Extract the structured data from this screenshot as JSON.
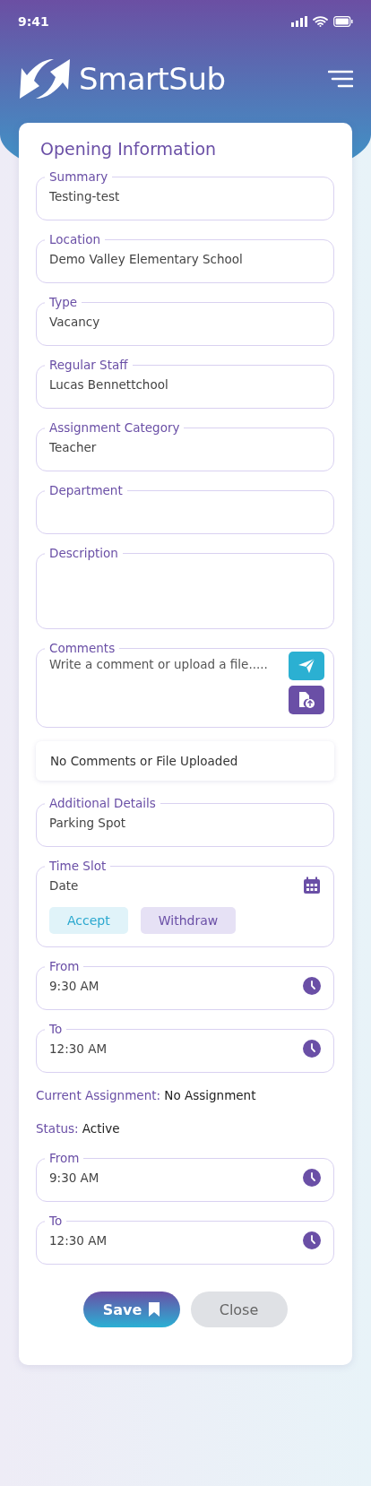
{
  "status_bar": {
    "time": "9:41"
  },
  "header": {
    "logo_text": "SmartSub"
  },
  "card": {
    "title": "Opening Information",
    "items": [
      {
        "kind": "field",
        "label": "Summary",
        "value": "Testing-test"
      },
      {
        "kind": "field",
        "label": "Location",
        "value": "Demo Valley Elementary School"
      },
      {
        "kind": "field",
        "label": "Type",
        "value": "Vacancy"
      },
      {
        "kind": "field",
        "label": "Regular Staff",
        "value": "Lucas Bennettchool"
      },
      {
        "kind": "field",
        "label": "Assignment Category",
        "value": "Teacher"
      },
      {
        "kind": "field",
        "label": "Department"
      },
      {
        "kind": "textarea",
        "label": "Description"
      },
      {
        "kind": "comments",
        "label": "Comments",
        "placeholder": "Write a comment or upload a file....."
      },
      {
        "kind": "note",
        "text": "No Comments or File Uploaded"
      },
      {
        "kind": "field",
        "label": "Additional Details",
        "value": "Parking Spot"
      },
      {
        "kind": "timeslot",
        "label": "Time Slot",
        "value": "Date",
        "actions": [
          {
            "label": "Accept",
            "kind": "accept"
          },
          {
            "label": "Withdraw",
            "kind": "withdraw"
          }
        ]
      },
      {
        "kind": "time",
        "label": "From",
        "value": "9:30 AM"
      },
      {
        "kind": "time",
        "label": "To",
        "value": "12:30 AM"
      },
      {
        "kind": "info",
        "label": "Current Assignment:",
        "value": "No Assignment"
      },
      {
        "kind": "info",
        "label": "Status:",
        "value": "Active"
      },
      {
        "kind": "time",
        "label": "From",
        "value": "9:30 AM"
      },
      {
        "kind": "time",
        "label": "To",
        "value": "12:30 AM"
      }
    ],
    "buttons": [
      {
        "label": "Save",
        "kind": "primary"
      },
      {
        "label": "Close",
        "kind": "secondary"
      }
    ]
  }
}
